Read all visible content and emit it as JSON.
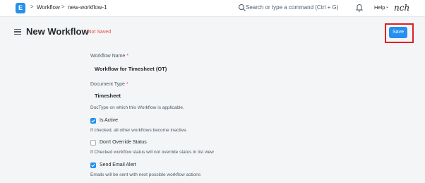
{
  "navbar": {
    "logo_letter": "E",
    "breadcrumbs": [
      "Workflow",
      "new-workflow-1"
    ],
    "search_placeholder": "Search or type a command (Ctrl + G)",
    "help_label": "Help",
    "avatar_text": "nch"
  },
  "page": {
    "title": "New Workflow",
    "status": "• Not Saved",
    "save_label": "Save"
  },
  "form": {
    "workflow_name": {
      "label": "Workflow Name",
      "required": "*",
      "value": "Workflow for Timesheet (OT)"
    },
    "document_type": {
      "label": "Document Type",
      "required": "*",
      "value": "Timesheet",
      "description": "DocType on which this Workflow is applicable."
    },
    "is_active": {
      "label": "Is Active",
      "checked": true,
      "description": "If checked, all other workflows become inactive."
    },
    "dont_override_status": {
      "label": "Don't Override Status",
      "checked": false,
      "description": "If Checked workflow status will not override status in list view"
    },
    "send_email_alert": {
      "label": "Send Email Alert",
      "checked": true,
      "description": "Emails will be sent with next possible workflow actions"
    }
  },
  "colors": {
    "accent": "#2490ef",
    "danger": "#e24c4c",
    "highlight": "#e02020"
  }
}
